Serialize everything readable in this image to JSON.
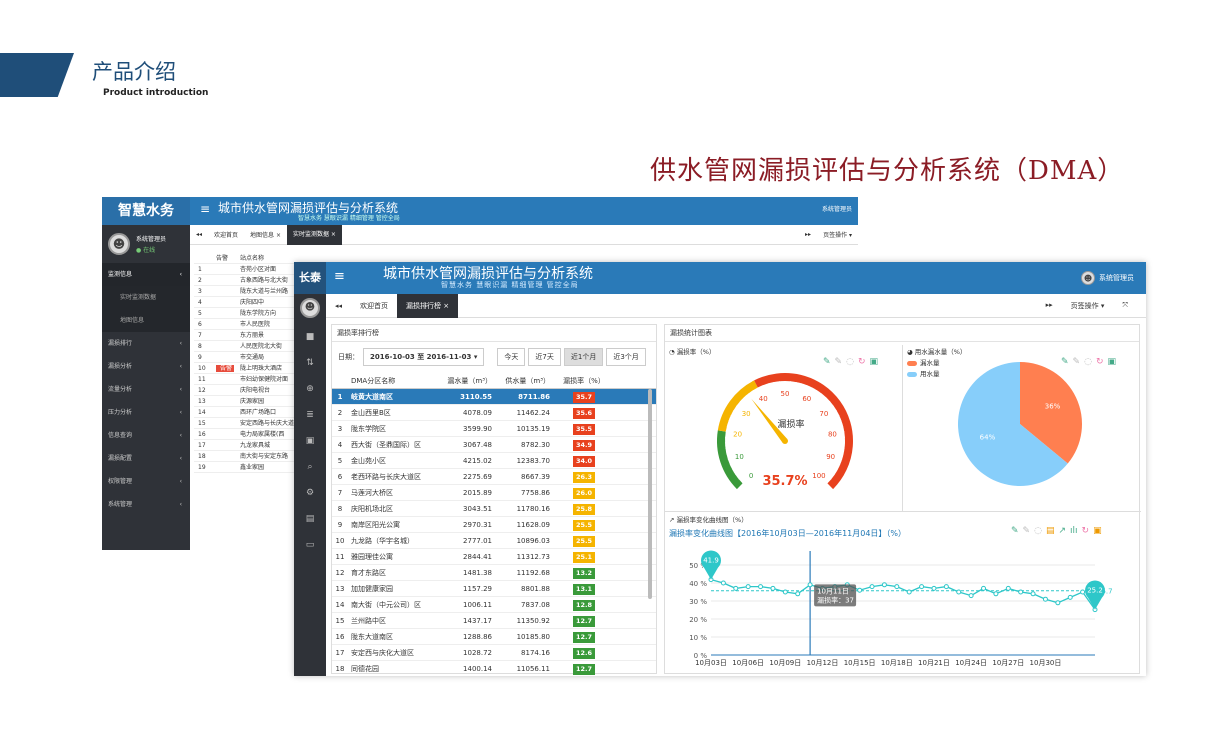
{
  "slide": {
    "title": "产品介绍",
    "subtitle": "Product  introduction",
    "heading": "供水管网漏损评估与分析系统（DMA）"
  },
  "back": {
    "brand": "智慧水务",
    "user": "系统管理员",
    "status": "● 在线",
    "title": "城市供水管网漏损评估与分析系统",
    "subtitle": "智慧水务 慧眼识漏 精细管理 管控全局",
    "user_top": "系统管理员",
    "menu": [
      "监测信息",
      "实时监测数据",
      "地图信息",
      "漏损排行",
      "漏损分析",
      "流量分析",
      "压力分析",
      "信息查询",
      "漏损配置",
      "权限管理",
      "系统管理"
    ],
    "tabs": [
      "欢迎首页",
      "地图信息 ×",
      "实时监测数据 ×"
    ],
    "tab_right": "页签操作 ▾",
    "table_header": [
      "告警",
      "站点名称"
    ],
    "rows": [
      {
        "no": "1",
        "alarm": "",
        "name": "杏苑小区对面"
      },
      {
        "no": "2",
        "alarm": "",
        "name": "古象西路与北大街"
      },
      {
        "no": "3",
        "alarm": "",
        "name": "陇东大道与兰州路"
      },
      {
        "no": "4",
        "alarm": "",
        "name": "庆阳四中"
      },
      {
        "no": "5",
        "alarm": "",
        "name": "陇东学院方向"
      },
      {
        "no": "6",
        "alarm": "",
        "name": "市人民医院"
      },
      {
        "no": "7",
        "alarm": "",
        "name": "东方丽景"
      },
      {
        "no": "8",
        "alarm": "",
        "name": "人民医院北大街"
      },
      {
        "no": "9",
        "alarm": "",
        "name": "市交通局"
      },
      {
        "no": "10",
        "alarm": "告警",
        "name": "陇上明珠大酒店"
      },
      {
        "no": "11",
        "alarm": "",
        "name": "市妇幼保健院对面"
      },
      {
        "no": "12",
        "alarm": "",
        "name": "庆阳电视台"
      },
      {
        "no": "13",
        "alarm": "",
        "name": "庆源家园"
      },
      {
        "no": "14",
        "alarm": "",
        "name": "西环广场路口"
      },
      {
        "no": "15",
        "alarm": "",
        "name": "安定西路与长庆大道"
      },
      {
        "no": "16",
        "alarm": "",
        "name": "电力局家属楼(西"
      },
      {
        "no": "17",
        "alarm": "",
        "name": "九龙家具城"
      },
      {
        "no": "18",
        "alarm": "",
        "name": "南大街与安定东路"
      },
      {
        "no": "19",
        "alarm": "",
        "name": "鑫业家园"
      }
    ]
  },
  "front": {
    "brand": "长泰",
    "menu_icon": "≡",
    "title": "城市供水管网漏损评估与分析系统",
    "subtitle": "智慧水务 慧眼识漏 精细管理 管控全局",
    "user": "系统管理员",
    "tabs": [
      {
        "label": "欢迎首页"
      },
      {
        "label": "漏损排行榜 ×"
      }
    ],
    "tab_right": "页签操作 ▾",
    "left_panel": {
      "title": "漏损率排行榜",
      "date_label": "日期：",
      "date_value": "2016-10-03 至 2016-11-03  ▾",
      "range_buttons": [
        "今天",
        "近7天",
        "近1个月",
        "近3个月"
      ],
      "columns": [
        "DMA分区名称",
        "漏水量（m³）",
        "供水量（m³）",
        "漏损率（%）"
      ],
      "rows": [
        {
          "no": "1",
          "name": "岐黄大道南区",
          "leak": "3110.55",
          "supply": "8711.86",
          "rate": "35.7",
          "color": "#e8411e"
        },
        {
          "no": "2",
          "name": "金山西里B区",
          "leak": "4078.09",
          "supply": "11462.24",
          "rate": "35.6",
          "color": "#e8411e"
        },
        {
          "no": "3",
          "name": "陇东学院区",
          "leak": "3599.90",
          "supply": "10135.19",
          "rate": "35.5",
          "color": "#e8411e"
        },
        {
          "no": "4",
          "name": "西大街（圣鼎国际）区",
          "leak": "3067.48",
          "supply": "8782.30",
          "rate": "34.9",
          "color": "#e8411e"
        },
        {
          "no": "5",
          "name": "金山苑小区",
          "leak": "4215.02",
          "supply": "12383.70",
          "rate": "34.0",
          "color": "#e8411e"
        },
        {
          "no": "6",
          "name": "老西环路与长庆大道区",
          "leak": "2275.69",
          "supply": "8667.39",
          "rate": "26.3",
          "color": "#f5b400"
        },
        {
          "no": "7",
          "name": "马莲河大桥区",
          "leak": "2015.89",
          "supply": "7758.86",
          "rate": "26.0",
          "color": "#f5b400"
        },
        {
          "no": "8",
          "name": "庆阳机场北区",
          "leak": "3043.51",
          "supply": "11780.16",
          "rate": "25.8",
          "color": "#f5b400"
        },
        {
          "no": "9",
          "name": "南岸区阳光公寓",
          "leak": "2970.31",
          "supply": "11628.09",
          "rate": "25.5",
          "color": "#f5b400"
        },
        {
          "no": "10",
          "name": "九龙路（华宇名城）",
          "leak": "2777.01",
          "supply": "10896.03",
          "rate": "25.5",
          "color": "#f5b400"
        },
        {
          "no": "11",
          "name": "雅园理佳公寓",
          "leak": "2844.41",
          "supply": "11312.73",
          "rate": "25.1",
          "color": "#f5b400"
        },
        {
          "no": "12",
          "name": "育才东路区",
          "leak": "1481.38",
          "supply": "11192.68",
          "rate": "13.2",
          "color": "#3a9a3a"
        },
        {
          "no": "13",
          "name": "加加健康家园",
          "leak": "1157.29",
          "supply": "8801.88",
          "rate": "13.1",
          "color": "#3a9a3a"
        },
        {
          "no": "14",
          "name": "南大街（中元公司）区",
          "leak": "1006.11",
          "supply": "7837.08",
          "rate": "12.8",
          "color": "#3a9a3a"
        },
        {
          "no": "15",
          "name": "兰州路中区",
          "leak": "1437.17",
          "supply": "11350.92",
          "rate": "12.7",
          "color": "#3a9a3a"
        },
        {
          "no": "16",
          "name": "陇东大道南区",
          "leak": "1288.86",
          "supply": "10185.80",
          "rate": "12.7",
          "color": "#3a9a3a"
        },
        {
          "no": "17",
          "name": "安定西与庆化大道区",
          "leak": "1028.72",
          "supply": "8174.16",
          "rate": "12.6",
          "color": "#3a9a3a"
        },
        {
          "no": "18",
          "name": "同德花园",
          "leak": "1400.14",
          "supply": "11056.11",
          "rate": "12.7",
          "color": "#3a9a3a"
        }
      ]
    },
    "right_panel": {
      "title": "漏损统计图表",
      "gauge_header": "漏损率（%）",
      "pie_header": "用水漏水量（%）",
      "line_header": "漏损率变化曲线图（%）",
      "line_title": "漏损率变化曲线图【2016年10月03日—2016年11月04日】（%）"
    }
  },
  "chart_data": [
    {
      "type": "gauge",
      "title": "漏损率",
      "value": 35.7,
      "value_label": "35.7%",
      "range": [
        0,
        100
      ],
      "ticks": [
        "0",
        "10",
        "20",
        "30",
        "40",
        "50",
        "60",
        "70",
        "80",
        "90",
        "100"
      ]
    },
    {
      "type": "pie",
      "labels": [
        "漏水量",
        "用水量"
      ],
      "values": [
        36,
        64
      ],
      "value_labels": [
        "36%",
        "64%"
      ],
      "colors": [
        "#ff7f50",
        "#87cefa"
      ]
    },
    {
      "type": "line",
      "x": [
        "10月03日",
        "10月04日",
        "10月05日",
        "10月06日",
        "10月07日",
        "10月08日",
        "10月09日",
        "10月10日",
        "10月11日",
        "10月12日",
        "10月13日",
        "10月14日",
        "10月15日",
        "10月16日",
        "10月17日",
        "10月18日",
        "10月19日",
        "10月20日",
        "10月21日",
        "10月22日",
        "10月23日",
        "10月24日",
        "10月25日",
        "10月26日",
        "10月27日",
        "10月28日",
        "10月29日",
        "10月30日",
        "10月31日",
        "11月01日",
        "11月02日",
        "11月03日"
      ],
      "x_ticks": [
        "10月03日",
        "10月06日",
        "10月09日",
        "10月12日",
        "10月15日",
        "10月18日",
        "10月21日",
        "10月24日",
        "10月27日",
        "10月30日"
      ],
      "values": [
        41.9,
        40,
        37,
        38,
        38,
        37,
        35,
        34,
        39,
        37,
        38,
        39,
        36,
        38,
        39,
        38,
        35,
        38,
        37,
        38,
        35,
        33,
        37,
        34,
        37,
        35,
        34,
        31,
        29,
        32,
        35,
        25.2
      ],
      "y_ticks": [
        "0 %",
        "10 %",
        "20 %",
        "30 %",
        "40 %",
        "50 %"
      ],
      "ylim": [
        0,
        50
      ],
      "max_label": "41.9",
      "min_label": "25.2",
      "mean_label": "35.7",
      "tooltip": {
        "x_index": 8,
        "line1": "10月11日",
        "line2": "漏损率：37"
      },
      "color": "#2ec7c9"
    }
  ]
}
